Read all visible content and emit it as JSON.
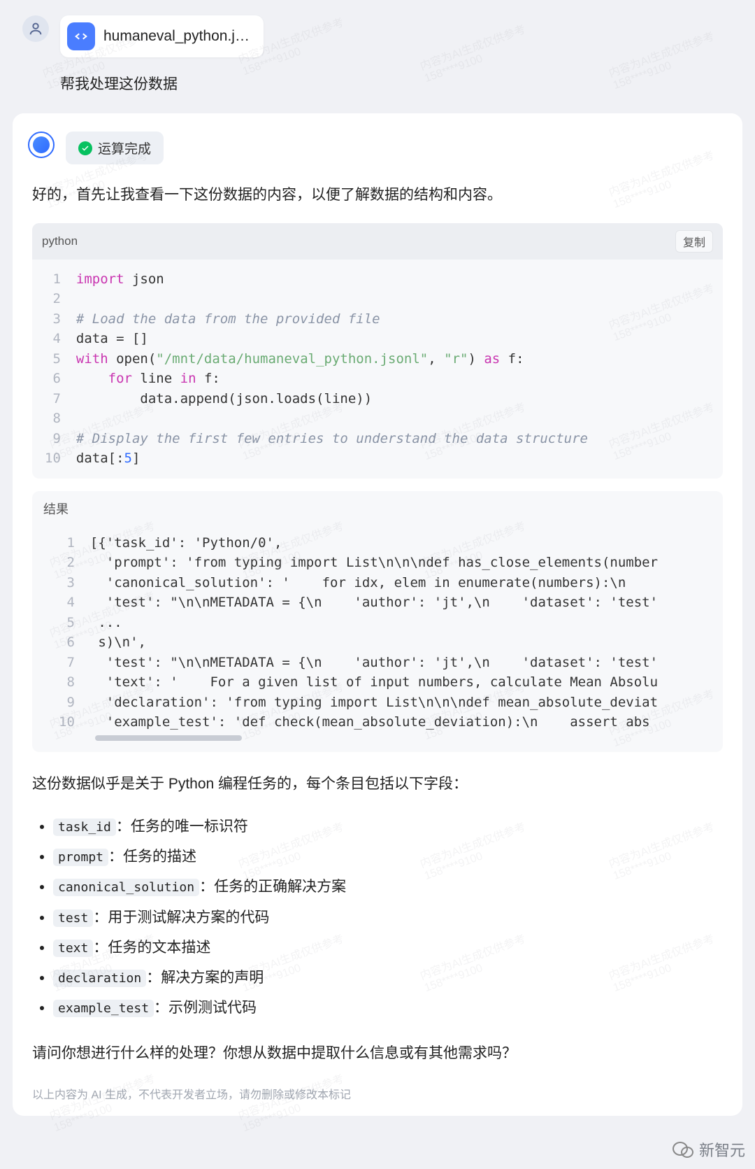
{
  "user": {
    "file_name": "humaneval_python.j…",
    "message": "帮我处理这份数据"
  },
  "ai": {
    "status": "运算完成",
    "intro": "好的，首先让我查看一下这份数据的内容，以便了解数据的结构和内容。",
    "code_lang": "python",
    "copy_label": "复制",
    "code_lines": {
      "l1a": "import",
      "l1b": " json",
      "l2": "",
      "l3": "# Load the data from the provided file",
      "l4": "data = []",
      "l5a": "with",
      "l5b": " open(",
      "l5c": "\"/mnt/data/humaneval_python.jsonl\"",
      "l5d": ", ",
      "l5e": "\"r\"",
      "l5f": ") ",
      "l5g": "as",
      "l5h": " f:",
      "l6a": "    ",
      "l6b": "for",
      "l6c": " line ",
      "l6d": "in",
      "l6e": " f:",
      "l7": "        data.append(json.loads(line))",
      "l8": "",
      "l9": "# Display the first few entries to understand the data structure",
      "l10a": "data[:",
      "l10b": "5",
      "l10c": "]"
    },
    "result_label": "结果",
    "result_lines": [
      "[{'task_id': 'Python/0',",
      "  'prompt': 'from typing import List\\n\\n\\ndef has_close_elements(number",
      "  'canonical_solution': '    for idx, elem in enumerate(numbers):\\n ",
      "  'test': \"\\n\\nMETADATA = {\\n    'author': 'jt',\\n    'dataset': 'test'",
      " ...",
      " s)\\n',",
      "  'test': \"\\n\\nMETADATA = {\\n    'author': 'jt',\\n    'dataset': 'test'",
      "  'text': '    For a given list of input numbers, calculate Mean Absolu",
      "  'declaration': 'from typing import List\\n\\n\\ndef mean_absolute_deviat",
      "  'example_test': 'def check(mean_absolute_deviation):\\n    assert abs"
    ],
    "summary": "这份数据似乎是关于 Python 编程任务的，每个条目包括以下字段：",
    "fields": [
      {
        "key": "task_id",
        "desc": "：任务的唯一标识符"
      },
      {
        "key": "prompt",
        "desc": "：任务的描述"
      },
      {
        "key": "canonical_solution",
        "desc": "：任务的正确解决方案"
      },
      {
        "key": "test",
        "desc": "：用于测试解决方案的代码"
      },
      {
        "key": "text",
        "desc": "：任务的文本描述"
      },
      {
        "key": "declaration",
        "desc": "：解决方案的声明"
      },
      {
        "key": "example_test",
        "desc": "：示例测试代码"
      }
    ],
    "followup": "请问你想进行什么样的处理？你想从数据中提取什么信息或有其他需求吗？",
    "disclaimer": "以上内容为 AI 生成，不代表开发者立场，请勿删除或修改本标记"
  },
  "watermark_source": "新智元",
  "faint_watermark": "内容为AI生成仅供参考\n158****9100"
}
